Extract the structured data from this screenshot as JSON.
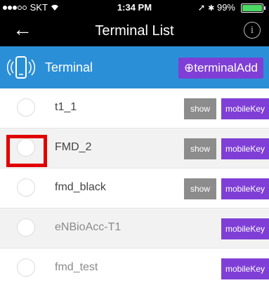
{
  "status_bar": {
    "carrier": "SKT",
    "time": "1:34 PM",
    "battery": "99%",
    "signal_full_dots": 3,
    "signal_empty_dots": 2
  },
  "nav": {
    "title": "Terminal List",
    "back_icon": "←",
    "info_icon": "i"
  },
  "header": {
    "label": "Terminal",
    "add_button": "⊕terminalAdd"
  },
  "terminals": [
    {
      "name": "t1_1",
      "show": "show",
      "mobile_key": "mobileKey"
    },
    {
      "name": "FMD_2",
      "show": "show",
      "mobile_key": "mobileKey"
    },
    {
      "name": "fmd_black",
      "show": "show",
      "mobile_key": "mobileKey"
    },
    {
      "name": "eNBioAcc-T1",
      "mobile_key": "mobileKey"
    },
    {
      "name": "fmd_test",
      "mobile_key": "mobileKey"
    }
  ],
  "colors": {
    "header_bg": "#2b8fd8",
    "accent_purple": "#7f3fd6",
    "show_gray": "#8c8c8c",
    "highlight_red": "#e00000"
  }
}
